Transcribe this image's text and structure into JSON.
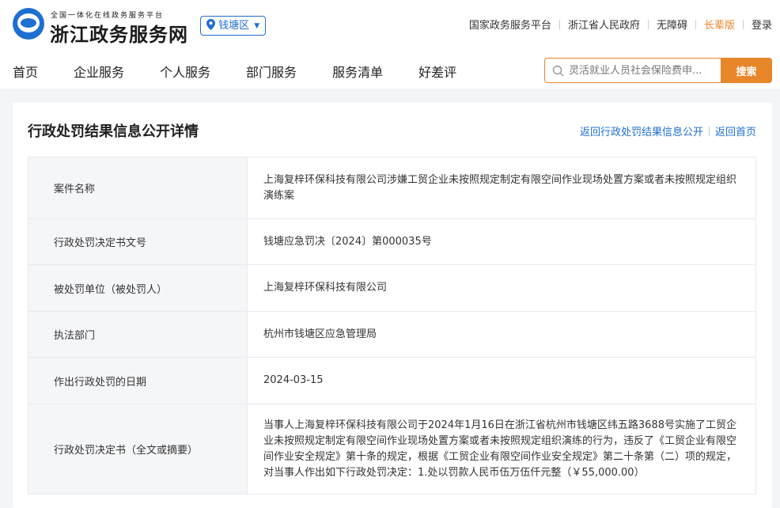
{
  "header": {
    "logo_icon": "zhejiang-gov-logo-icon",
    "logo_sub": "全国一体化在线政务服务平台",
    "logo_main": "浙江政务服务网",
    "region": "钱塘区",
    "top_links": [
      "国家政务服务平台",
      "浙江省人民政府",
      "无障碍",
      "长辈版",
      "登录"
    ],
    "elder_color": "#e8862a"
  },
  "nav": {
    "items": [
      "首页",
      "企业服务",
      "个人服务",
      "部门服务",
      "服务清单",
      "好差评"
    ]
  },
  "search": {
    "placeholder": "灵活就业人员社会保险费申...",
    "button": "搜索",
    "accent": "#e8862a"
  },
  "card": {
    "title": "行政处罚结果信息公开详情",
    "links": [
      "返回行政处罚结果信息公开",
      "返回首页"
    ],
    "link_color": "#1f6fd1"
  },
  "rows": [
    {
      "label": "案件名称",
      "value": "上海复梓环保科技有限公司涉嫌工贸企业未按照规定制定有限空间作业现场处置方案或者未按照规定组织演练案"
    },
    {
      "label": "行政处罚决定书文号",
      "value": "钱塘应急罚决〔2024〕第000035号"
    },
    {
      "label": "被处罚单位（被处罚人）",
      "value": "上海复梓环保科技有限公司"
    },
    {
      "label": "执法部门",
      "value": "杭州市钱塘区应急管理局"
    },
    {
      "label": "作出行政处罚的日期",
      "value": "2024-03-15"
    },
    {
      "label": "行政处罚决定书（全文或摘要）",
      "value": "当事人上海复梓环保科技有限公司于2024年1月16日在浙江省杭州市钱塘区纬五路3688号实施了工贸企业未按照规定制定有限空间作业现场处置方案或者未按照规定组织演练的行为，违反了《工贸企业有限空间作业安全规定》第十条的规定，根据《工贸企业有限空间作业安全规定》第二十条第（二）项的规定，对当事人作出如下行政处罚决定：1.处以罚款人民币伍万伍仟元整（￥55,000.00）"
    }
  ]
}
